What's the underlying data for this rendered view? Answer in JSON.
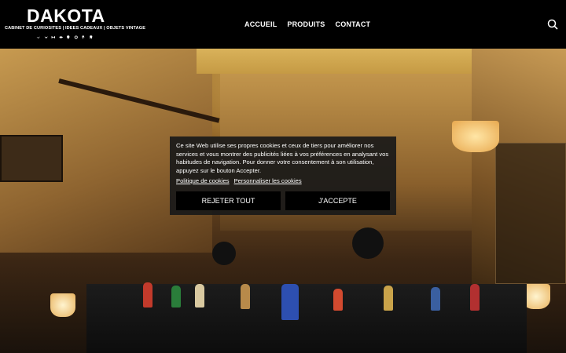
{
  "brand": {
    "title": "DAKOTA",
    "subtitle": "CABINET DE CURIOSITES | IDEES CADEAUX | OBJETS VINTAGE",
    "icons": [
      "bird-icon",
      "bird-icon",
      "butterfly-icon",
      "fish-icon",
      "bulb-icon",
      "ring-icon",
      "lamp-icon",
      "tooth-icon"
    ]
  },
  "nav": {
    "items": [
      {
        "label": "ACCUEIL"
      },
      {
        "label": "PRODUITS"
      },
      {
        "label": "CONTACT"
      }
    ]
  },
  "search": {
    "icon": "search-icon"
  },
  "cookie": {
    "text": "Ce site Web utilise ses propres cookies et ceux de tiers pour améliorer nos services et vous montrer des publicités liées à vos préférences en analysant vos habitudes de navigation. Pour donner votre consentement à son utilisation, appuyez sur le bouton Accepter.",
    "policy_link": "Politique de cookies",
    "customize_link": "Personnaliser les cookies",
    "reject_label": "REJETER TOUT",
    "accept_label": "J'ACCEPTE"
  },
  "colors": {
    "header_bg": "#000000",
    "dialog_bg": "#191919",
    "text": "#ffffff"
  }
}
